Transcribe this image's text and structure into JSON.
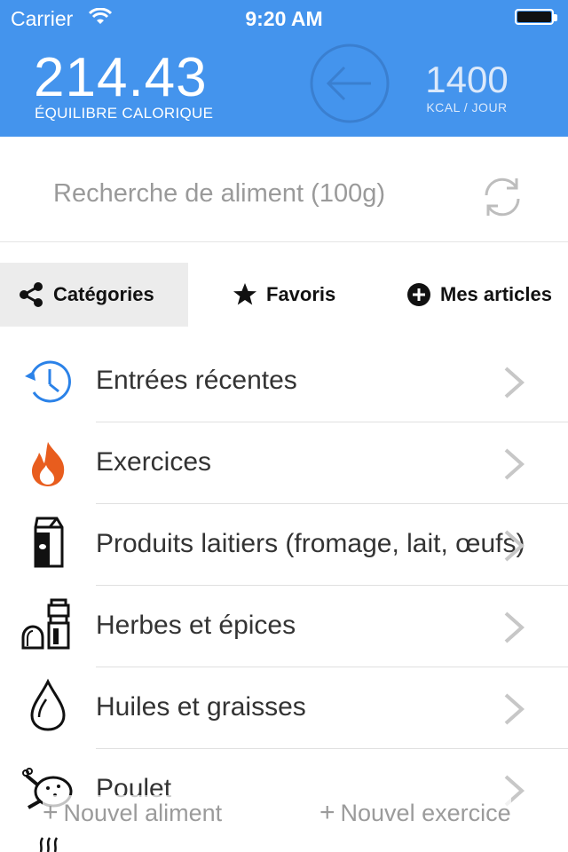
{
  "status_bar": {
    "carrier": "Carrier",
    "time": "9:20 AM"
  },
  "header": {
    "balance_value": "214.43",
    "balance_label": "ÉQUILIBRE CALORIQUE",
    "goal_value": "1400",
    "goal_unit": "KCAL / JOUR",
    "accent_color": "#4494ed"
  },
  "search": {
    "placeholder": "Recherche de aliment (100g)"
  },
  "tabs": [
    {
      "label": "Catégories",
      "icon": "share-icon",
      "active": true
    },
    {
      "label": "Favoris",
      "icon": "star-icon",
      "active": false
    },
    {
      "label": "Mes articles",
      "icon": "plus-circle-icon",
      "active": false
    }
  ],
  "categories": [
    {
      "label": "Entrées récentes",
      "icon": "clock-history-icon"
    },
    {
      "label": "Exercices",
      "icon": "flame-icon"
    },
    {
      "label": "Produits laitiers (fromage, lait, œufs)",
      "icon": "milk-carton-icon"
    },
    {
      "label": "Herbes et épices",
      "icon": "pepper-grinder-icon"
    },
    {
      "label": "Huiles et graisses",
      "icon": "oil-drop-icon"
    },
    {
      "label": "Poulet",
      "icon": "chicken-icon"
    }
  ],
  "actions": {
    "new_food": "Nouvel aliment",
    "new_exercise": "Nouvel exercice"
  }
}
